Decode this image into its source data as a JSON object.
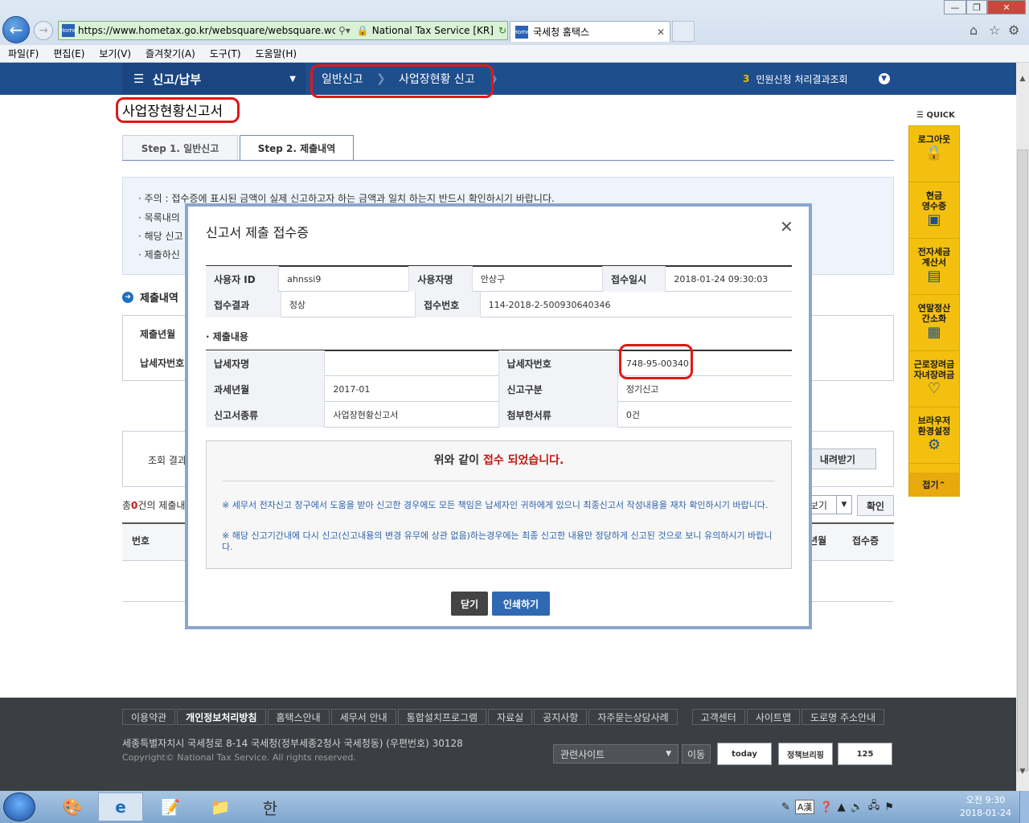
{
  "browser": {
    "url": "https://www.hometax.go.kr/websquare/websquare.wq?w2x",
    "cert": "National Tax Service [KR]",
    "tab_title": "국세청 홈택스",
    "favicon_text": "Home"
  },
  "menubar": [
    "파일(F)",
    "편집(E)",
    "보기(V)",
    "즐겨찾기(A)",
    "도구(T)",
    "도움말(H)"
  ],
  "topnav": {
    "menu_label": "신고/납부",
    "crumb1": "일반신고",
    "crumb2": "사업장현황 신고",
    "right_num": "3",
    "right_label": "민원신청 처리결과조회"
  },
  "page": {
    "title": "사업장현황신고서",
    "step1": "Step 1. 일반신고",
    "step2": "Step 2. 제출내역",
    "notices": [
      "주의 : 접수증에 표시된 금액이 실제 신고하고자 하는 금액과 일치 하는지 반드시 확인하시기 바랍니다.",
      "목록내의",
      "해당 신고",
      "제출하신"
    ],
    "section_title": "제출내역",
    "search_label1": "제출년월",
    "search_label2": "납세자번호",
    "result_label": "조회 결과",
    "download_btn": "내려받기",
    "count_prefix": "총",
    "count_value": "0",
    "count_suffix": "건의 제출내",
    "view_select": "보기",
    "confirm_btn": "확인",
    "col_no": "번호",
    "col_period": "과세년월",
    "col_receipt": "접수증"
  },
  "quick": {
    "title": "QUICK",
    "items": [
      {
        "label": "로그아웃",
        "icon": "lock-icon"
      },
      {
        "label": "현금\n영수증",
        "icon": "receipt-icon"
      },
      {
        "label": "전자세금\n계산서",
        "icon": "invoice-icon"
      },
      {
        "label": "연말정산\n간소화",
        "icon": "calculator-icon"
      },
      {
        "label": "근로장려금\n자녀장려금",
        "icon": "heart-icon"
      },
      {
        "label": "브라우저\n환경설정",
        "icon": "gear-icon"
      }
    ],
    "fold": "접기"
  },
  "modal": {
    "title": "신고서 제출 접수증",
    "user_id_label": "사용자 ID",
    "user_id": "ahnssi9",
    "user_name_label": "사용자명",
    "user_name": "안상구",
    "receipt_time_label": "접수일시",
    "receipt_time": "2018-01-24 09:30:03",
    "result_label": "접수결과",
    "result": "정상",
    "receipt_no_label": "접수번호",
    "receipt_no": "114-2018-2-500930640346",
    "sub_title": "제출내용",
    "taxpayer_name_label": "납세자명",
    "taxpayer_name": "",
    "taxpayer_no_label": "납세자번호",
    "taxpayer_no": "748-95-00340",
    "period_label": "과세년월",
    "period": "2017-01",
    "report_type_label": "신고구분",
    "report_type": "정기신고",
    "form_label": "신고서종류",
    "form": "사업장현황신고서",
    "attach_label": "첨부한서류",
    "attach": "0건",
    "msg_prefix": "위와 같이",
    "msg_red": "접수 되었습니다.",
    "note1": "※ 세무서 전자신고 창구에서 도움을 받아 신고한 경우에도 모든 책임은 납세자인 귀하에게 있으니 최종신고서 작성내용을 재차 확인하시기 바랍니다.",
    "note2": "※ 해당 신고기간내에 다시 신고(신고내용의 변경 유무에 상관 없음)하는경우에는 최종 신고한 내용만 정당하게 신고된 것으로 보니 유의하시기 바랍니다.",
    "close_btn": "닫기",
    "print_btn": "인쇄하기"
  },
  "footer": {
    "links": [
      "이용약관",
      "개인정보처리방침",
      "홈택스안내",
      "세무서 안내",
      "통합설치프로그램",
      "자료실",
      "공지사항",
      "자주묻는상담사례",
      "고객센터",
      "사이트맵",
      "도로명 주소안내"
    ],
    "address": "세종특별자치시 국세청로 8-14 국세청(정부세종2청사 국세청동) (우편번호) 30128",
    "copyright": "Copyright© National Tax Service. All rights reserved.",
    "related_select": "관련사이트",
    "move_btn": "이동",
    "banner1": "today",
    "banner2": "정책브리핑",
    "banner3": "125"
  },
  "taskbar": {
    "ime": "A漢",
    "time": "오전 9:30",
    "date": "2018-01-24"
  },
  "colors": {
    "nav": "#1f4e8c",
    "quick": "#f3c010",
    "highlight": "#e01818",
    "footer": "#3b3f44"
  }
}
